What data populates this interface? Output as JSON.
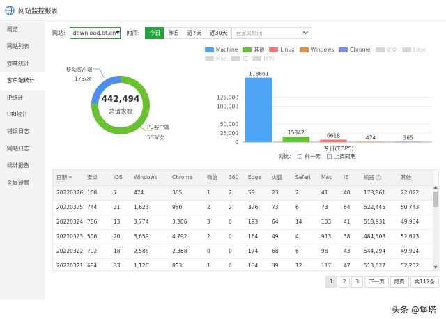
{
  "window": {
    "title": "网站监控报表"
  },
  "sidebar": {
    "items": [
      {
        "label": "概览",
        "active": false
      },
      {
        "label": "网站列表",
        "active": false
      },
      {
        "label": "蜘蛛统计",
        "active": false
      },
      {
        "label": "客户端统计",
        "active": true
      },
      {
        "label": "IP统计",
        "active": false
      },
      {
        "label": "URI统计",
        "active": false
      },
      {
        "label": "错误日志",
        "active": false
      },
      {
        "label": "网站日志",
        "active": false
      },
      {
        "label": "统计报告",
        "active": false
      },
      {
        "label": "全局设置",
        "active": false
      }
    ]
  },
  "filters": {
    "site_label": "网站:",
    "site_value": "download.bt.cn",
    "time_label": "时间:",
    "time_buttons": [
      "今日",
      "昨日",
      "近7天",
      "近30天"
    ],
    "active_time": "今日",
    "custom_placeholder": "自定义时间"
  },
  "donut": {
    "total": "442,494",
    "total_label": "总请求数",
    "mobile_label": "移动客户端",
    "mobile_value": "175/次",
    "pc_label": "PC客户端",
    "pc_value": "553/次",
    "mobile_count": 175,
    "pc_count": 553,
    "colors": {
      "mobile": "#4e8ef7",
      "pc": "#68c22e"
    }
  },
  "legend": [
    {
      "name": "Machine",
      "color": "#4da6f5",
      "off": false
    },
    {
      "name": "其他",
      "color": "#60c234",
      "off": false
    },
    {
      "name": "Linux",
      "color": "#f07474",
      "off": false
    },
    {
      "name": "Windows",
      "color": "#f08a3c",
      "off": false
    },
    {
      "name": "Chrome",
      "color": "#7a8ef5",
      "off": false
    },
    {
      "name": "安卓",
      "color": "#d8d8d8",
      "off": true
    },
    {
      "name": "Edge",
      "color": "#d8d8d8",
      "off": true
    },
    {
      "name": "Mac",
      "color": "#d8d8d8",
      "off": true
    },
    {
      "name": "IE",
      "color": "#d8d8d8",
      "off": true
    },
    {
      "name": "搜狗",
      "color": "#d8d8d8",
      "off": true
    }
  ],
  "chart_data": {
    "type": "bar",
    "categories": [
      "Machine",
      "其他",
      "Linux",
      "Windows",
      "Chrome"
    ],
    "values": [
      178861,
      15342,
      6618,
      474,
      365
    ],
    "colors": [
      "#4da6f5",
      "#60c234",
      "#f07474",
      "#f08a3c",
      "#7a8ef5"
    ],
    "data_labels": [
      "178861",
      "15342",
      "6618",
      "474",
      "365"
    ],
    "yticks": [
      "0",
      "25,000",
      "50,000",
      "100,000",
      "125,000"
    ],
    "ytick_values": [
      0,
      25000,
      50000,
      100000,
      125000
    ],
    "ylim": [
      0,
      180000
    ],
    "xlabel": "今日(TOP5)",
    "ylabel": "",
    "title": ""
  },
  "compare": {
    "label": "对比:",
    "prev": "前一天",
    "last_week": "上周同期"
  },
  "table": {
    "headers": [
      "日期",
      "安卓",
      "iOS",
      "Windows",
      "Chrome",
      "微信",
      "360",
      "Edge",
      "火狐",
      "Safari",
      "Mac",
      "IE",
      "机器",
      "其他"
    ],
    "rows": [
      [
        "20220326",
        "168",
        "7",
        "474",
        "365",
        "1",
        "2",
        "59",
        "23",
        "2",
        "41",
        "40",
        "178,861",
        "22,022"
      ],
      [
        "20220325",
        "744",
        "21",
        "1,623",
        "980",
        "2",
        "2",
        "326",
        "73",
        "6",
        "73",
        "64",
        "522,445",
        "50,743"
      ],
      [
        "20220324",
        "756",
        "13",
        "3,774",
        "3,306",
        "3",
        "0",
        "193",
        "64",
        "14",
        "103",
        "41",
        "518,931",
        "49,934"
      ],
      [
        "20220323",
        "506",
        "20",
        "3,659",
        "4,792",
        "2",
        "0",
        "164",
        "49",
        "4",
        "913",
        "38",
        "484,308",
        "52,673"
      ],
      [
        "20220322",
        "792",
        "18",
        "2,588",
        "2,368",
        "0",
        "0",
        "174",
        "68",
        "6",
        "98",
        "43",
        "544,294",
        "49,924"
      ],
      [
        "20220321",
        "684",
        "33",
        "1,126",
        "833",
        "1",
        "0",
        "134",
        "39",
        "12",
        "117",
        "47",
        "513,027",
        "52,232"
      ]
    ]
  },
  "pager": {
    "pages": [
      "1",
      "2",
      "3"
    ],
    "next": "下一页",
    "last": "尾页",
    "total": "共117条"
  },
  "watermark": "头条 @堡塔"
}
